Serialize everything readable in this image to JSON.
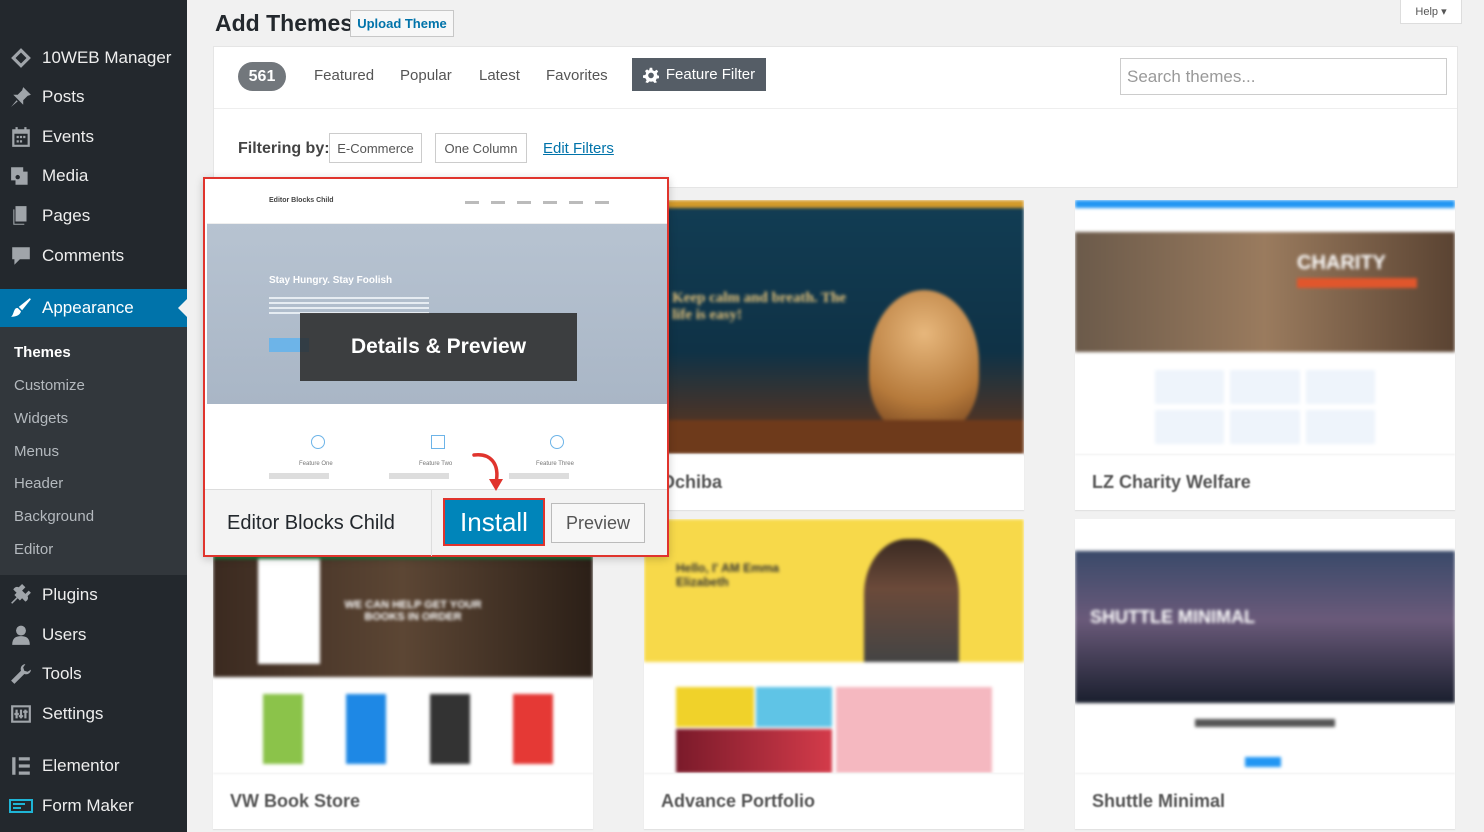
{
  "sidebar": {
    "items": [
      {
        "label": "10WEB Manager",
        "icon": "diamond-icon"
      },
      {
        "label": "Posts",
        "icon": "pushpin-icon"
      },
      {
        "label": "Events",
        "icon": "calendar-icon"
      },
      {
        "label": "Media",
        "icon": "media-icon"
      },
      {
        "label": "Pages",
        "icon": "pages-icon"
      },
      {
        "label": "Comments",
        "icon": "comment-icon"
      },
      {
        "label": "Appearance",
        "icon": "brush-icon"
      },
      {
        "label": "Plugins",
        "icon": "plug-icon"
      },
      {
        "label": "Users",
        "icon": "user-icon"
      },
      {
        "label": "Tools",
        "icon": "wrench-icon"
      },
      {
        "label": "Settings",
        "icon": "settings-icon"
      },
      {
        "label": "Elementor",
        "icon": "elementor-icon"
      },
      {
        "label": "Form Maker",
        "icon": "form-icon"
      }
    ],
    "submenu": [
      "Themes",
      "Customize",
      "Widgets",
      "Menus",
      "Header",
      "Background",
      "Editor"
    ]
  },
  "header": {
    "title": "Add Themes",
    "upload_label": "Upload Theme",
    "help_label": "Help ▾"
  },
  "filters": {
    "count": "561",
    "tabs": [
      "Featured",
      "Popular",
      "Latest",
      "Favorites"
    ],
    "feature_filter_label": "Feature Filter",
    "search_placeholder": "Search themes...",
    "filtering_label": "Filtering by:",
    "tags": [
      "E-Commerce",
      "One Column"
    ],
    "edit_filters_label": "Edit Filters"
  },
  "highlight": {
    "name": "Editor Blocks Child",
    "install_label": "Install",
    "preview_label": "Preview",
    "overlay_label": "Details & Preview",
    "screenshot": {
      "site_title": "Editor Blocks Child",
      "hero_heading": "Stay Hungry. Stay Foolish",
      "features": [
        "Feature One",
        "Feature Two",
        "Feature Three"
      ]
    }
  },
  "themes": [
    {
      "name": "Ochiba",
      "hero": "Keep calm and breath. The life is easy!"
    },
    {
      "name": "LZ Charity Welfare",
      "hero": "CHARITY"
    },
    {
      "name": "VW Book Store",
      "hero": "WE CAN HELP GET YOUR BOOKS IN ORDER"
    },
    {
      "name": "Advance Portfolio",
      "hero": "Hello, I' AM Emma Elizabeth"
    },
    {
      "name": "Shuttle Minimal",
      "hero": "SHUTTLE MINIMAL"
    }
  ],
  "colors": {
    "sidebar_bg": "#23282d",
    "accent": "#0073aa",
    "highlight_border": "#e0342d"
  }
}
